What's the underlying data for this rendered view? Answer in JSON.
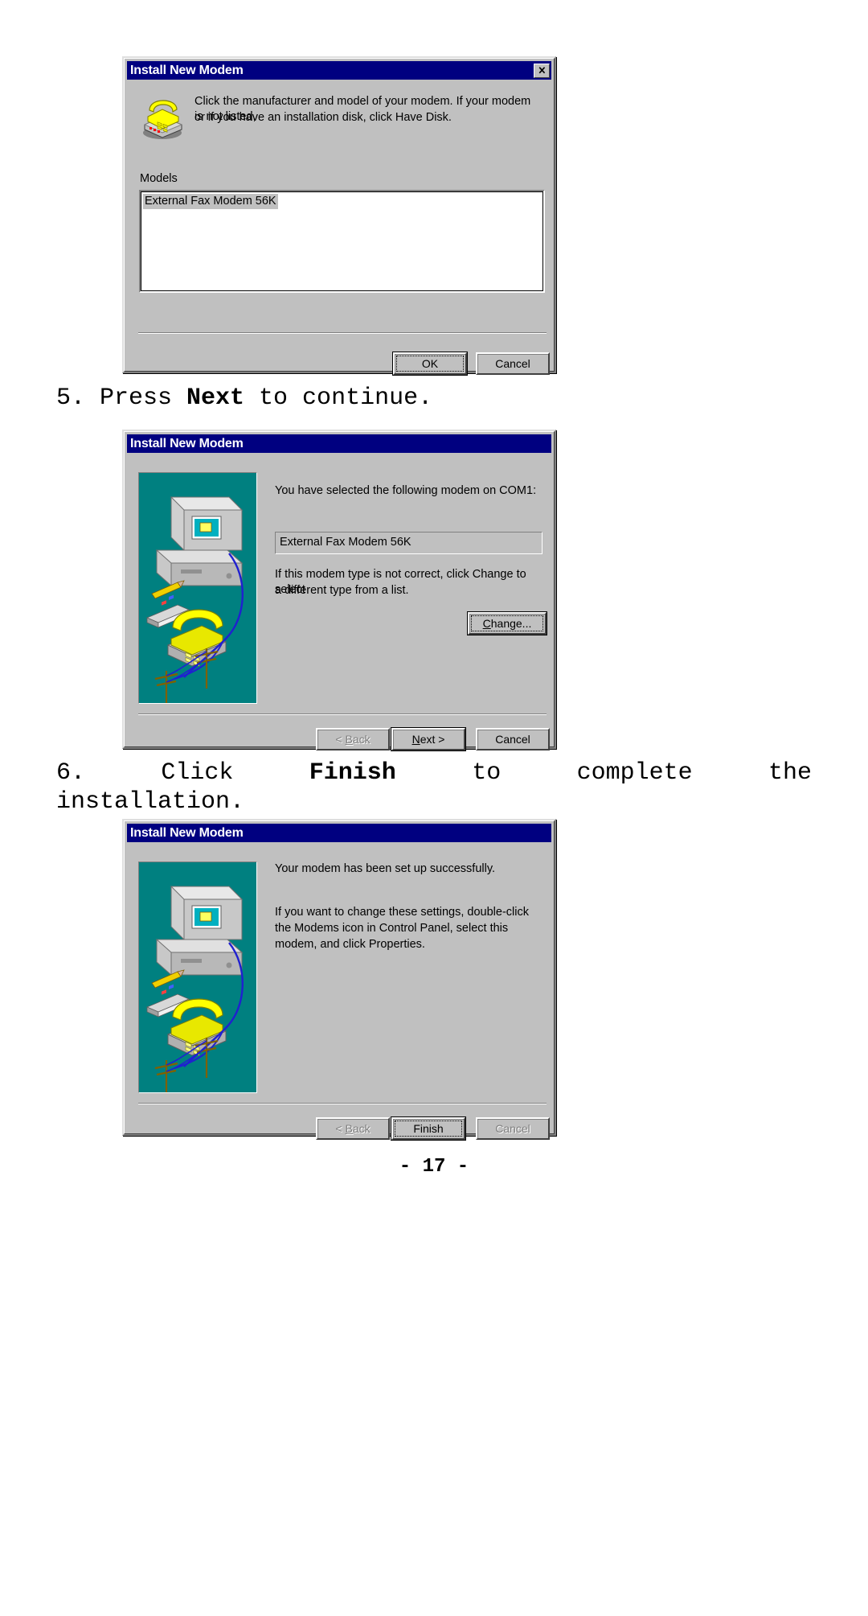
{
  "page": {
    "number_label": "-  17  -"
  },
  "steps": [
    {
      "id": "step5",
      "prefix": "5. Press ",
      "bold": "Next",
      "suffix": " to continue."
    },
    {
      "id": "step6",
      "prefix": "6. Click ",
      "bold": "Finish",
      "suffix": " to  complete  the",
      "line2": "installation."
    }
  ],
  "dialog1": {
    "title": "Install New Modem",
    "close_label": "✕",
    "icon_name": "modem-phone-icon",
    "body_line1": "Click the manufacturer and model of your modem. If your modem is not listed,",
    "body_line2": "or if you have an installation disk, click Have Disk.",
    "models_label": "Models",
    "models": [
      "External Fax Modem 56K"
    ],
    "buttons": {
      "ok": "OK",
      "cancel": "Cancel"
    }
  },
  "dialog2": {
    "title": "Install New Modem",
    "heading": "You have selected the following modem on COM1:",
    "selected_modem": "External Fax Modem 56K",
    "note_line1": "If this modem type is not correct, click Change to select",
    "note_line2": "a different type from a list.",
    "change_button": "Change...",
    "buttons": {
      "back": "< Back",
      "next": "Next >",
      "cancel": "Cancel"
    }
  },
  "dialog3": {
    "title": "Install New Modem",
    "heading": "Your modem has been set up successfully.",
    "note_line1": "If you want to change these settings, double-click",
    "note_line2": "the Modems icon in Control Panel, select this",
    "note_line3": "modem, and click Properties.",
    "buttons": {
      "back": "< Back",
      "finish": "Finish",
      "cancel": "Cancel"
    }
  },
  "colors": {
    "titlebar": "#000080",
    "dialog_face": "#c0c0c0",
    "wizard_art_bg": "#008080",
    "list_bg": "#ffffff",
    "phone_yellow": "#ffff00"
  }
}
